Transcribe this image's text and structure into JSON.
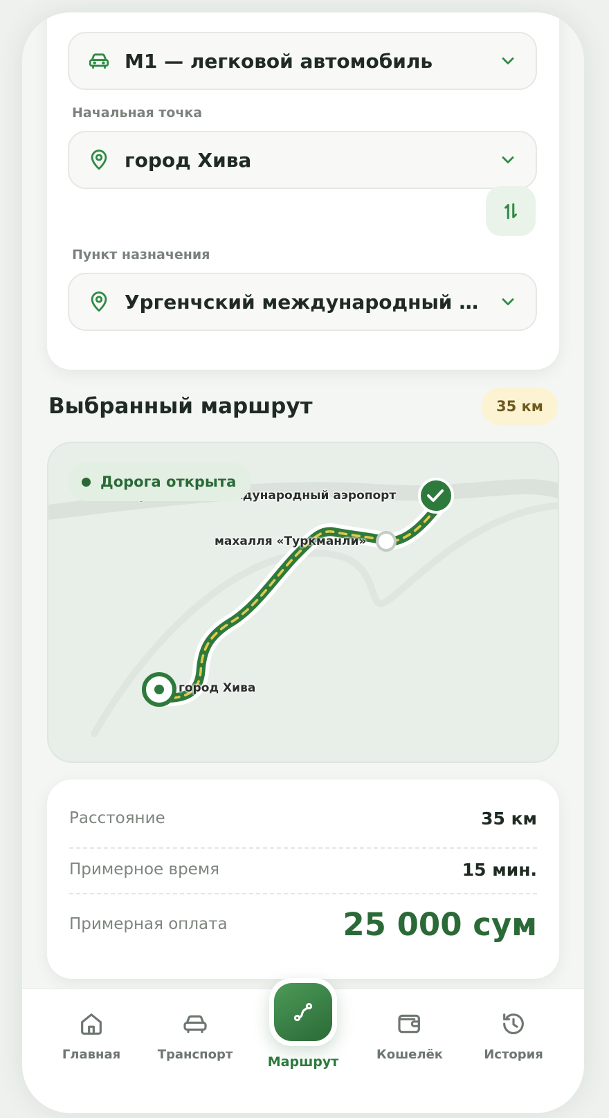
{
  "form": {
    "vehicle": {
      "value": "M1 — легковой автомобиль",
      "icon": "car-icon"
    },
    "start": {
      "label": "Начальная точка",
      "value": "город Хива",
      "icon": "location-pin-icon"
    },
    "destination": {
      "label": "Пункт назначения",
      "value": "Ургенчский международный аэропорт",
      "icon": "location-pin-icon"
    },
    "swap_icon": "swap-vertical-icon"
  },
  "route": {
    "title": "Выбранный маршрут",
    "distance_badge": "35 км",
    "status": "Дорога открыта",
    "points": {
      "start": "город Хива",
      "via": "махалля «Туркманли»",
      "end": "Ургенчский международный аэропорт"
    }
  },
  "summary": {
    "distance_label": "Расстояние",
    "distance_value": "35 км",
    "time_label": "Примерное время",
    "time_value": "15 мин.",
    "price_label": "Примерная оплата",
    "price_value": "25 000 сум"
  },
  "nav": {
    "items": [
      {
        "label": "Главная",
        "icon": "home-icon"
      },
      {
        "label": "Транспорт",
        "icon": "car-icon"
      },
      {
        "label": "Маршрут",
        "icon": "route-icon",
        "active": true
      },
      {
        "label": "Кошелёк",
        "icon": "wallet-icon"
      },
      {
        "label": "История",
        "icon": "history-icon"
      }
    ]
  },
  "colors": {
    "primary": "#2b6a37",
    "accent_route": "#2e7a3c",
    "route_dash": "#e3c94a",
    "badge_bg": "#fcf3d2",
    "background": "#f4f6f3"
  }
}
